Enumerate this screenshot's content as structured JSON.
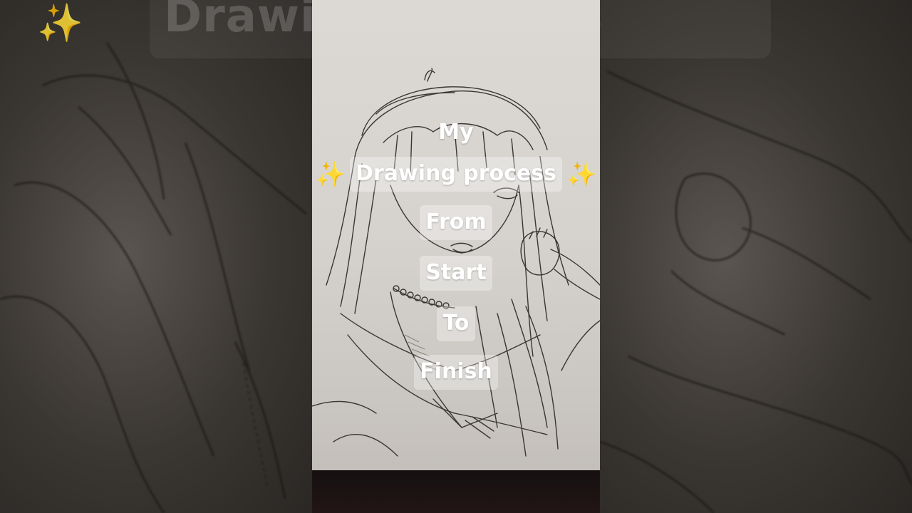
{
  "video": {
    "caption_lines": [
      "My",
      "Drawing process",
      "From",
      "Start",
      "To",
      "Finish"
    ],
    "sparkle_emoji": "✨"
  },
  "background": {
    "blurred_title": "Drawing process"
  },
  "colors": {
    "caption_text": "#ffffff",
    "caption_box": "rgba(255,255,255,0.32)",
    "paper": "#d8d4d0",
    "pencil": "#3a3633"
  }
}
